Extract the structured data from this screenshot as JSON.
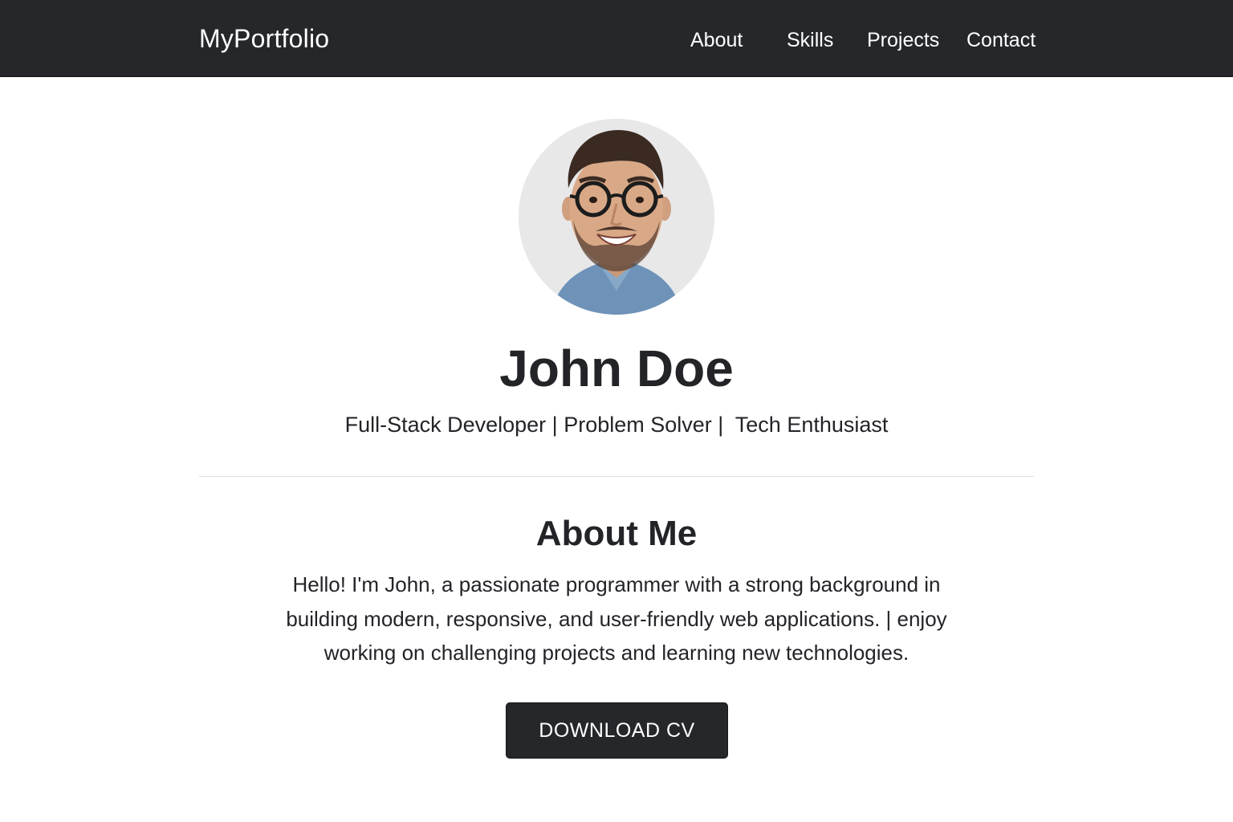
{
  "nav": {
    "brand": "MyPortfolio",
    "links": [
      {
        "label": "About"
      },
      {
        "label": "Skills"
      },
      {
        "label": "Projects"
      },
      {
        "label": "Contact"
      }
    ]
  },
  "profile": {
    "name": "John Doe",
    "tagline": "Full-Stack Developer | Problem Solver |  Tech Enthusiast"
  },
  "about": {
    "title": "About Me",
    "paragraph": "Hello! I'm John, a passionate programmer with a strong background in building modern, responsive, and user-friendly web applications. | enjoy working on challenging projects and learning new technologies."
  },
  "actions": {
    "download_cv_label": "DOWNLOAD CV"
  },
  "colors": {
    "navbar_bg": "#25272b",
    "text": "#222428",
    "button_bg": "#25272b",
    "divider": "#dedfe1"
  }
}
